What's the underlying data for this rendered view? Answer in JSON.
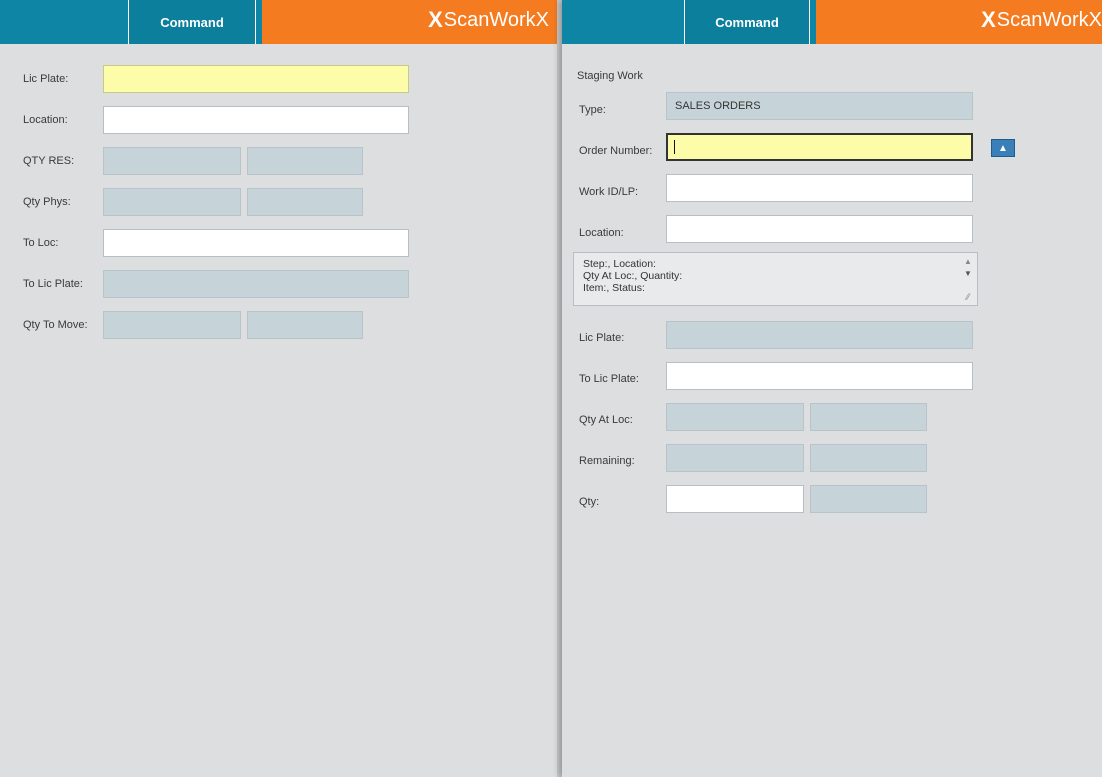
{
  "left": {
    "header": {
      "command_label": "Command",
      "brand": "ScanWorkX",
      "brand_mark": "X"
    },
    "fields": {
      "lic_plate_label": "Lic Plate:",
      "location_label": "Location:",
      "qty_res_label": "QTY RES:",
      "qty_phys_label": "Qty Phys:",
      "to_loc_label": "To Loc:",
      "to_lic_plate_label": "To Lic Plate:",
      "qty_to_move_label": "Qty To Move:"
    }
  },
  "right": {
    "header": {
      "command_label": "Command",
      "brand": "ScanWorkX",
      "brand_mark": "X"
    },
    "section_title": "Staging Work",
    "type": {
      "label": "Type:",
      "value": "SALES ORDERS"
    },
    "order_number": {
      "label": "Order Number:",
      "value": ""
    },
    "work_id": {
      "label": "Work ID/LP:"
    },
    "location": {
      "label": "Location:"
    },
    "memo_lines": [
      "Step:, Location:",
      "Qty At Loc:, Quantity:",
      "Item:, Status:"
    ],
    "lic_plate": {
      "label": "Lic Plate:"
    },
    "to_lic_plate": {
      "label": "To Lic Plate:"
    },
    "qty_at_loc": {
      "label": "Qty At Loc:"
    },
    "remaining": {
      "label": "Remaining:"
    },
    "qty": {
      "label": "Qty:"
    }
  },
  "colors": {
    "header_teal": "#0e85a4",
    "brand_orange": "#f47b20",
    "highlight_yellow": "#fdfca8",
    "readonly_field": "#c6d3d8"
  }
}
